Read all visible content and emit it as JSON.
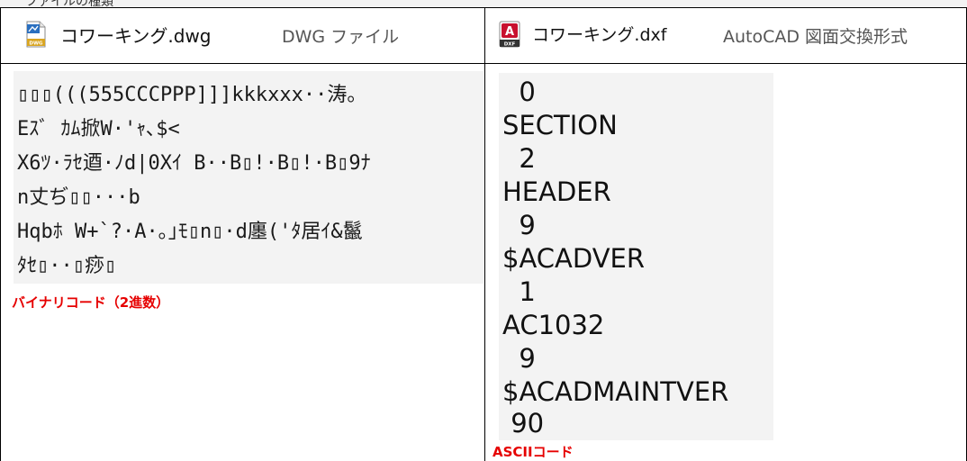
{
  "top_strip_text": "ファイルの種類",
  "left_header": {
    "filename": "コワーキング.dwg",
    "filetype": "DWG ファイル",
    "icon": "dwg-file-icon"
  },
  "right_header": {
    "filename": "コワーキング.dxf",
    "filetype": "AutoCAD 図面交換形式",
    "icon": "dxf-file-icon"
  },
  "binary_lines": [
    "▯▯▯(((555CCCPPP]]]kkkxxx··涛。",
    "Eｽﾞ ｶﾑ掀W·'ｬ､$<",
    "X6ﾂ·ﾗｾ逎·ﾉd|0Xｲ B··B▯!·B▯!·B▯9ﾅ",
    "n丈ぢ▯▯···b",
    "Hqbﾎ W+`?·A·｡｣ﾓ▯n▯·d廛('ﾀ居ｲ&鬣",
    "ﾀｾ▯··▯痧▯"
  ],
  "binary_label": "バイナリコード（2進数）",
  "ascii_lines": [
    "  0",
    "SECTION",
    "  2",
    "HEADER",
    "  9",
    "$ACADVER",
    "  1",
    "AC1032",
    "  9",
    "$ACADMAINTVER",
    " 90"
  ],
  "ascii_label": "ASCIIコード",
  "colors": {
    "label_red": "#e60000",
    "box_bg": "#f3f3f3",
    "dxf_icon_red": "#c8102e",
    "dwg_icon_blue": "#2a6fbf"
  }
}
